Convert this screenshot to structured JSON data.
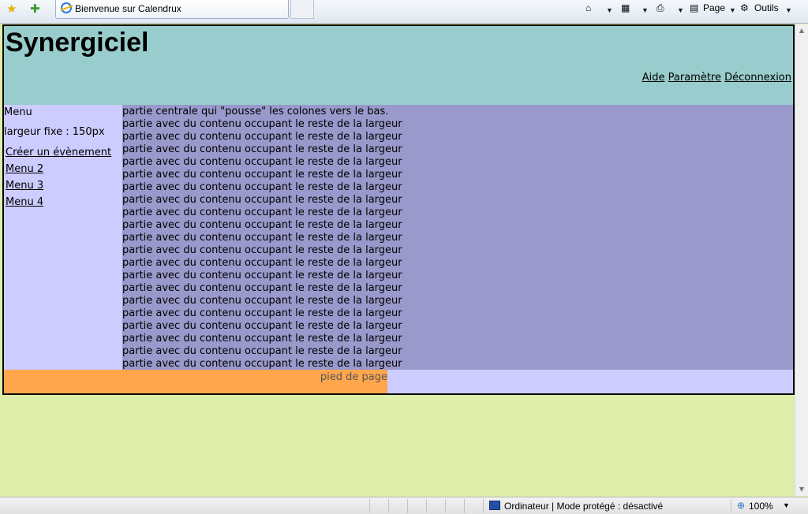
{
  "browser": {
    "tab_title": "Bienvenue sur Calendrux",
    "toolbar": {
      "home_icon": "home-icon",
      "feeds_icon": "rss-icon",
      "print_icon": "printer-icon",
      "page_label": "Page",
      "tools_label": "Outils"
    },
    "status": {
      "zone": "Ordinateur | Mode protégé : désactivé",
      "zoom": "100%"
    }
  },
  "header": {
    "title": "Synergiciel",
    "nav": [
      "Aide",
      "Paramètre",
      "Déconnexion"
    ]
  },
  "sidebar": {
    "heading": "Menu",
    "width_note": "largeur fixe : 150px",
    "links": [
      "Créer un évènement",
      "Menu 2",
      "Menu 3",
      "Menu 4"
    ]
  },
  "main": {
    "first_line": "partie centrale qui \"pousse\" les colones vers le bas.",
    "repeated_line": "partie avec du contenu occupant le reste de la largeur",
    "repeat_count": 20
  },
  "footer": {
    "text": "pied de page"
  },
  "colors": {
    "header_bg": "#99cccc",
    "sidebar_bg": "#ccccff",
    "main_bg": "#9999cc",
    "footer_bg": "#ffa64d",
    "body_bg": "#dfedaa"
  }
}
